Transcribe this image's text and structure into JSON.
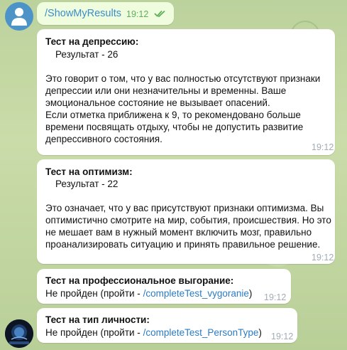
{
  "outgoing": {
    "text": "/ShowMyResults",
    "time": "19:12",
    "read_checks": "double-check-icon"
  },
  "messages": [
    {
      "title": "Тест на депрессию:",
      "result": "Результат - 26",
      "lines": [
        "Это говорит о том, что у вас полностью отсутствуют признаки",
        "депрессии или они незначительны и временны. Ваше",
        "эмоциональное состояние не вызывает опасений.",
        "Если отметка приближена к 9, то рекомендовано больше",
        "времени посвящать отдыху, чтобы не допустить развитие",
        "депрессивного состояния."
      ],
      "time": "19:12"
    },
    {
      "title": "Тест на оптимизм:",
      "result": "Результат - 22",
      "lines": [
        "Это означает, что у вас присутствуют признаки оптимизма. Вы",
        "оптимистично смотрите на мир, события, происшествия. Но это",
        "не мешает вам в нужный момент включить мозг, правильно",
        "проанализировать ситуацию и принять правильное решение."
      ],
      "time": "19:12"
    },
    {
      "title": "Тест на профессиональное выгорание:",
      "status_prefix": "Не пройден (пройти - ",
      "command": "/completeTest_vygoranie",
      "status_suffix": ")",
      "time": "19:12"
    },
    {
      "title": "Тест на тип личности:",
      "status_prefix": "Не пройден (пройти - ",
      "command": "/completeTest_PersonType",
      "status_suffix": ")",
      "time": "19:12"
    }
  ],
  "colors": {
    "outgoing_bubble": "#effdde",
    "incoming_bubble": "#ffffff",
    "link": "#2b7cc4",
    "timestamp": "#a2acb4",
    "read_check": "#5fae5a"
  }
}
